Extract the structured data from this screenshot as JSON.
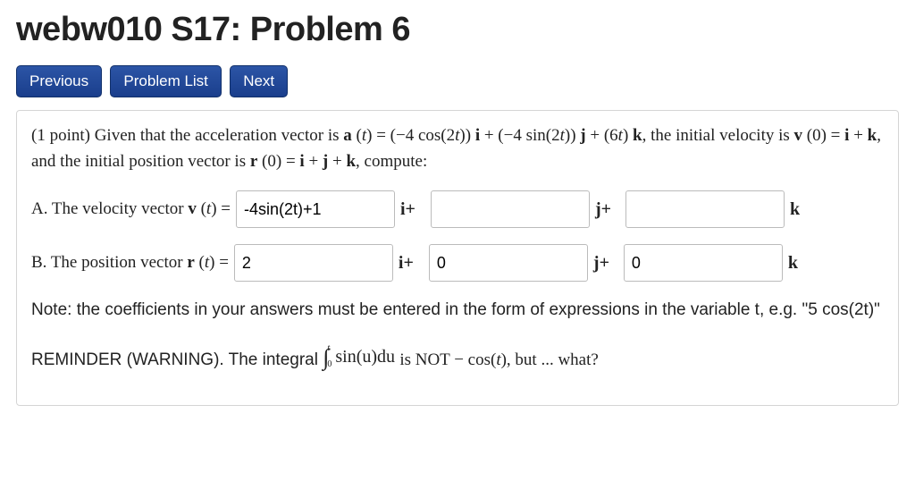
{
  "page_title": "webw010 S17: Problem 6",
  "nav": {
    "previous": "Previous",
    "problem_list": "Problem List",
    "next": "Next"
  },
  "problem": {
    "intro": "(1 point) Given that the acceleration vector is a (t) = (−4 cos(2t)) i + (−4 sin(2t)) j + (6t) k, the initial velocity is v (0) = i + k, and the initial position vector is r (0) = i + j + k, compute:",
    "partA": {
      "label": "A. The velocity vector v (t) =",
      "i_value": "-4sin(2t)+1",
      "j_value": "",
      "k_value": ""
    },
    "partB": {
      "label": "B. The position vector r (t) =",
      "i_value": "2",
      "j_value": "0",
      "k_value": "0"
    },
    "basis": {
      "i": "i+",
      "j": "j+",
      "k": "k"
    },
    "note": "Note: the coefficients in your answers must be entered in the form of expressions in the variable t, e.g. \"5 cos(2t)\"",
    "reminder_prefix": "REMINDER (WARNING). The integral ",
    "integral": {
      "upper": "t",
      "lower": "0",
      "integrand": "sin(u)du"
    },
    "reminder_suffix": " is NOT − cos(t), but ... what?"
  }
}
